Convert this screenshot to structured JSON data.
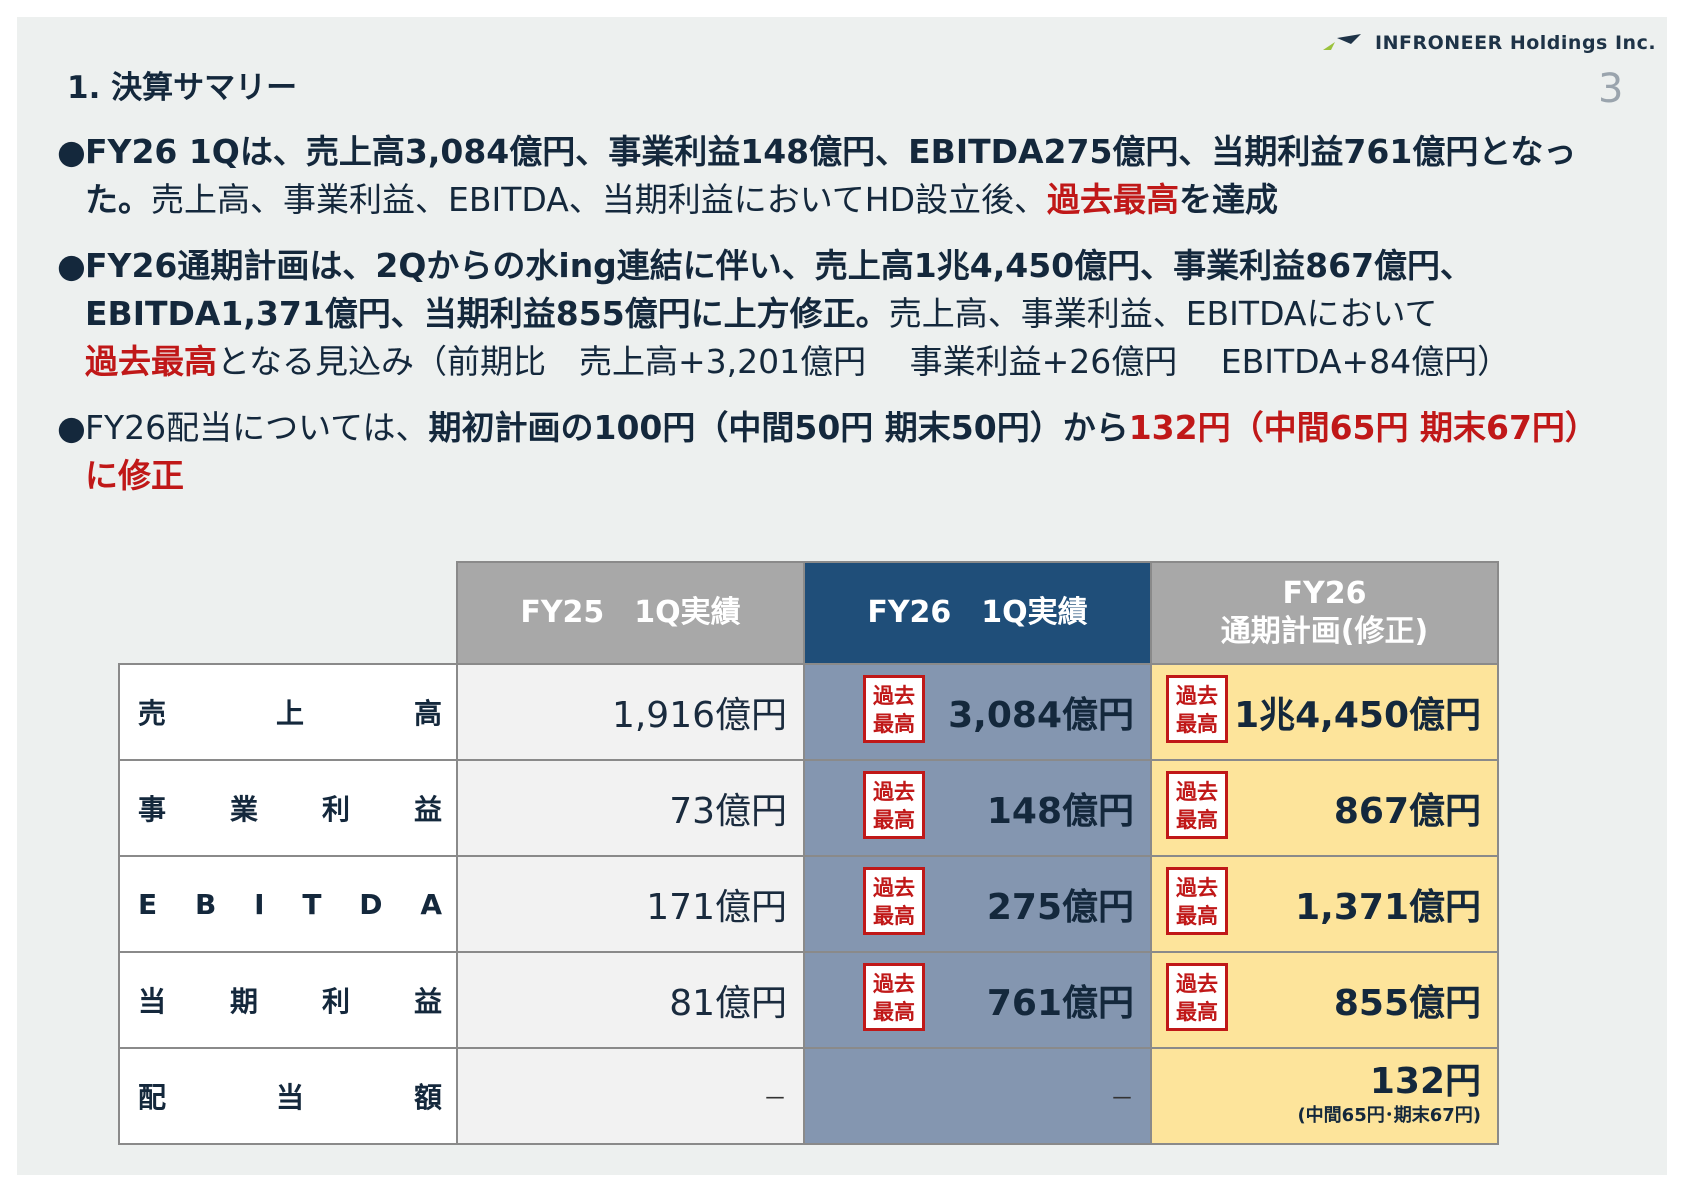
{
  "header": {
    "company": "INFRONEER Holdings Inc.",
    "page_number": "3",
    "title": "1.  決算サマリー"
  },
  "bullets": [
    {
      "line1_bold": "FY26 1Qは、売上高3,084億円、事業利益148億円、EBITDA275億円、当期利益761億円となっ",
      "line2_bold": "た。",
      "line2_normal": "売上高、事業利益、EBITDA、当期利益においてHD設立後、",
      "line2_red": "過去最高",
      "line2_tail": "を達成"
    },
    {
      "line1_bold": "FY26通期計画は、2Qからの水ing連結に伴い、売上高1兆4,450億円、事業利益867億円、",
      "line2_bold": "EBITDA1,371億円、当期利益855億円に上方修正。",
      "line2_normal": "売上高、事業利益、EBITDAにおいて",
      "line3_red": "過去最高",
      "line3_normal": "となる見込み（前期比　売上高+3,201億円　 事業利益+26億円　 EBITDA+84億円）"
    },
    {
      "line1_normal": "FY26配当については、",
      "line1_bold": "期初計画の100円（中間50円 期末50円）から",
      "line1_red": "132円（中間65円 期末67円）",
      "line2_red": "に修正"
    }
  ],
  "table": {
    "col_fy25": "FY25　1Q実績",
    "col_fy26": "FY26　1Q実績",
    "col_plan_line1": "FY26",
    "col_plan_line2": "通期計画(修正)",
    "record_stamp_line1": "過去",
    "record_stamp_line2": "最高",
    "rows": [
      {
        "label": [
          "売",
          "上",
          "高"
        ],
        "fy25": "1,916億円",
        "fy26": "3,084億円",
        "plan": "1兆4,450億円",
        "fy26_record": true,
        "plan_record": true
      },
      {
        "label": [
          "事",
          "業",
          "利",
          "益"
        ],
        "fy25": "73億円",
        "fy26": "148億円",
        "plan": "867億円",
        "fy26_record": true,
        "plan_record": true
      },
      {
        "label": [
          "E",
          "B",
          "I",
          "T",
          "D",
          "A"
        ],
        "fy25": "171億円",
        "fy26": "275億円",
        "plan": "1,371億円",
        "fy26_record": true,
        "plan_record": true
      },
      {
        "label": [
          "当",
          "期",
          "利",
          "益"
        ],
        "fy25": "81億円",
        "fy26": "761億円",
        "plan": "855億円",
        "fy26_record": true,
        "plan_record": true
      },
      {
        "label": [
          "配",
          "当",
          "額"
        ],
        "fy25": "－",
        "fy26": "－",
        "plan": "132円",
        "plan_sub": "(中間65円･期末67円)",
        "fy26_record": false,
        "plan_record": false
      }
    ]
  },
  "colors": {
    "background": "#edf0ef",
    "navy_header": "#1f4e79",
    "gray_header": "#a8a8a8",
    "fy26_cell": "#8496b0",
    "plan_cell": "#fde49b",
    "record_red": "#c01818"
  }
}
